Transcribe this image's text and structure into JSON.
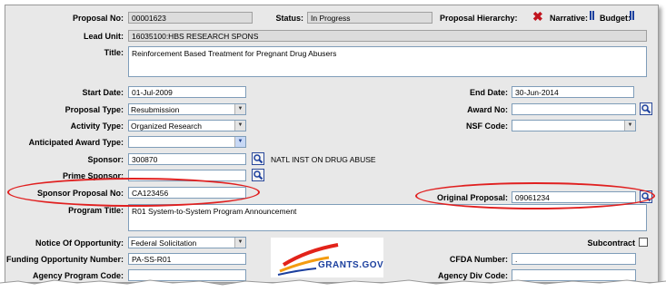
{
  "header": {
    "proposal_no_label": "Proposal No:",
    "proposal_no": "00001623",
    "status_label": "Status:",
    "status": "In Progress",
    "hierarchy_label": "Proposal Hierarchy:",
    "narrative_label": "Narrative:",
    "budget_label": "Budget:"
  },
  "fields": {
    "lead_unit_label": "Lead Unit:",
    "lead_unit": "16035100:HBS RESEARCH SPONS",
    "title_label": "Title:",
    "title": "Reinforcement Based Treatment for Pregnant Drug Abusers",
    "start_date_label": "Start Date:",
    "start_date": "01-Jul-2009",
    "end_date_label": "End Date:",
    "end_date": "30-Jun-2014",
    "proposal_type_label": "Proposal Type:",
    "proposal_type": "Resubmission",
    "award_no_label": "Award No:",
    "award_no": "",
    "activity_type_label": "Activity Type:",
    "activity_type": "Organized Research",
    "nsf_code_label": "NSF Code:",
    "nsf_code": "",
    "anticipated_award_type_label": "Anticipated Award Type:",
    "anticipated_award_type": "",
    "sponsor_label": "Sponsor:",
    "sponsor": "300870",
    "sponsor_name": "NATL INST ON DRUG ABUSE",
    "prime_sponsor_label": "Prime Sponsor:",
    "prime_sponsor": "",
    "sponsor_proposal_no_label": "Sponsor Proposal No:",
    "sponsor_proposal_no": "CA123456",
    "original_proposal_label": "Original Proposal:",
    "original_proposal": "09061234",
    "program_title_label": "Program Title:",
    "program_title": "R01 System-to-System Program Announcement",
    "notice_label": "Notice Of Opportunity:",
    "notice": "Federal Solicitation",
    "subcontract_label": "Subcontract",
    "funding_opp_label": "Funding Opportunity Number:",
    "funding_opp": "PA-SS-R01",
    "cfda_label": "CFDA Number:",
    "cfda": ".",
    "agency_program_code_label": "Agency Program Code:",
    "agency_program_code": "",
    "agency_div_code_label": "Agency Div Code:",
    "agency_div_code": "",
    "grants_logo_text": "GRANTS.GOV"
  },
  "colors": {
    "highlight_oval": "#e02020",
    "field_border": "#7f9db9",
    "panel_bg": "#e8e8e8"
  }
}
